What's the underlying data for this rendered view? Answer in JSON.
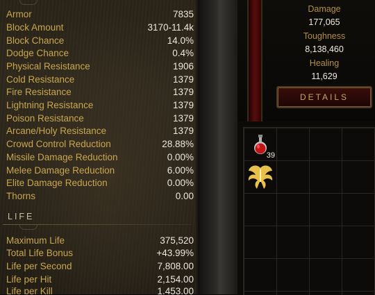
{
  "defense": [
    {
      "label": "Armor",
      "value": "7835"
    },
    {
      "label": "Block Amount",
      "value": "3170-11.4k"
    },
    {
      "label": "Block Chance",
      "value": "14.0%"
    },
    {
      "label": "Dodge Chance",
      "value": "0.4%"
    },
    {
      "label": "Physical Resistance",
      "value": "1906"
    },
    {
      "label": "Cold Resistance",
      "value": "1379"
    },
    {
      "label": "Fire Resistance",
      "value": "1379"
    },
    {
      "label": "Lightning Resistance",
      "value": "1379"
    },
    {
      "label": "Poison Resistance",
      "value": "1379"
    },
    {
      "label": "Arcane/Holy Resistance",
      "value": "1379"
    },
    {
      "label": "Crowd Control Reduction",
      "value": "28.88%"
    },
    {
      "label": "Missile Damage Reduction",
      "value": "0.00%"
    },
    {
      "label": "Melee Damage Reduction",
      "value": "6.00%"
    },
    {
      "label": "Elite Damage Reduction",
      "value": "0.00%"
    },
    {
      "label": "Thorns",
      "value": "0.00"
    }
  ],
  "life_section": {
    "title": "LIFE",
    "rows": [
      {
        "label": "Maximum Life",
        "value": "375,520"
      },
      {
        "label": "Total Life Bonus",
        "value": "+43.99%"
      },
      {
        "label": "Life per Second",
        "value": "7,808.00"
      },
      {
        "label": "Life per Hit",
        "value": "2,154.00"
      },
      {
        "label": "Life per Kill",
        "value": "1,453.00"
      }
    ]
  },
  "summary": {
    "damage_label": "Damage",
    "damage_value": "177,065",
    "toughness_label": "Toughness",
    "toughness_value": "8,138,460",
    "healing_label": "Healing",
    "healing_value": "11,629",
    "details_button": "DETAILS"
  },
  "inventory": {
    "potion_count": "39",
    "slot1_icon": "health-potion-icon",
    "slot2_icon": "golden-wings-icon"
  },
  "colors": {
    "label": "#c8a74f",
    "value": "#ede7da",
    "summary_label": "#b38f45",
    "health_bar": "#5a0c0c"
  }
}
